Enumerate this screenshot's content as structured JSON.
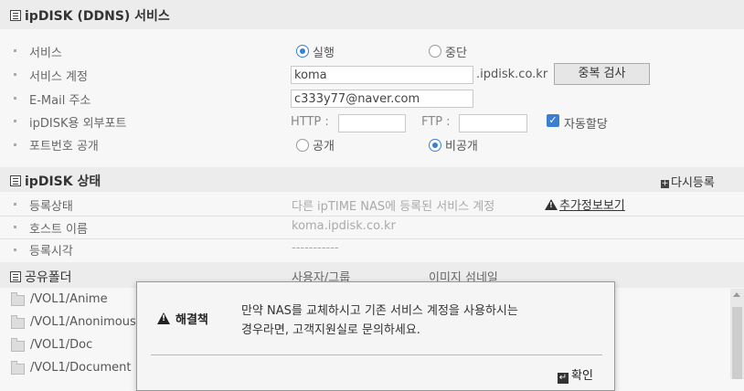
{
  "ddns": {
    "title": "ipDISK (DDNS) 서비스",
    "service_label": "서비스",
    "service_on": "실행",
    "service_off": "중단",
    "account_label": "서비스 계정",
    "account_value": "koma",
    "domain_suffix": ".ipdisk.co.kr",
    "dup_check_button": "중복 검사",
    "email_label": "E-Mail 주소",
    "email_value": "c333y77@naver.com",
    "port_label": "ipDISK용 외부포트",
    "http_label": "HTTP :",
    "http_value": "",
    "ftp_label": "FTP :",
    "ftp_value": "",
    "auto_assign_label": "자동할당",
    "auto_assign_checked": true,
    "port_public_label": "포트번호 공개",
    "public_option": "공개",
    "private_option": "비공개"
  },
  "status": {
    "title": "ipDISK 상태",
    "reregister_link": "다시등록",
    "reg_status_label": "등록상태",
    "reg_status_value": "다른 ipTIME NAS에 등록된 서비스 계정",
    "more_info_link": "추가정보보기",
    "host_label": "호스트 이름",
    "host_value": "koma.ipdisk.co.kr",
    "reg_time_label": "등록시각",
    "reg_time_value": "-----------"
  },
  "shared": {
    "title": "공유폴더",
    "col_user_group": "사용자/그룹",
    "col_thumbnail": "이미지 섬네일",
    "folders": [
      "/VOL1/Anime",
      "/VOL1/Anonimous",
      "/VOL1/Doc",
      "/VOL1/Document"
    ]
  },
  "dialog": {
    "title": "해결책",
    "message_line1": "만약 NAS를 교체하시고 기존 서비스 계정을 사용하시는",
    "message_line2": "경우라면, 고객지원실로 문의하세요.",
    "ok_button": "확인"
  },
  "colors": {
    "accent": "#3b7fd0",
    "section_header_bg": "#ececec"
  }
}
